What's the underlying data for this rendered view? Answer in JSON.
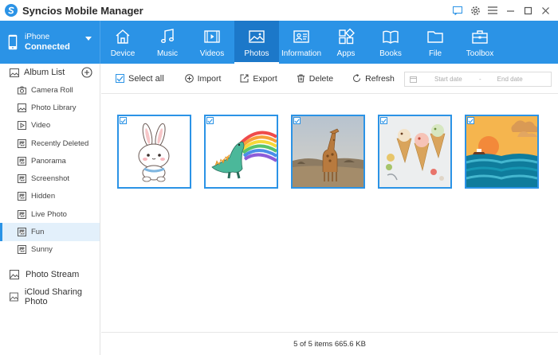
{
  "app": {
    "title": "Syncios Mobile Manager"
  },
  "device": {
    "name": "iPhone",
    "status": "Connected"
  },
  "nav": {
    "tabs": [
      {
        "label": "Device",
        "icon": "home-icon"
      },
      {
        "label": "Music",
        "icon": "music-icon"
      },
      {
        "label": "Videos",
        "icon": "film-icon"
      },
      {
        "label": "Photos",
        "icon": "image-icon",
        "active": true
      },
      {
        "label": "Information",
        "icon": "contact-card-icon"
      },
      {
        "label": "Apps",
        "icon": "apps-icon"
      },
      {
        "label": "Books",
        "icon": "book-icon"
      },
      {
        "label": "File",
        "icon": "folder-icon"
      },
      {
        "label": "Toolbox",
        "icon": "toolbox-icon"
      }
    ]
  },
  "sidebar": {
    "album_header": "Album List",
    "albums": [
      {
        "label": "Camera Roll",
        "icon": "camera-icon"
      },
      {
        "label": "Photo Library",
        "icon": "photo-icon"
      },
      {
        "label": "Video",
        "icon": "play-icon"
      },
      {
        "label": "Recently Deleted",
        "icon": "album-icon"
      },
      {
        "label": "Panorama",
        "icon": "album-icon"
      },
      {
        "label": "Screenshot",
        "icon": "album-icon"
      },
      {
        "label": "Hidden",
        "icon": "album-icon"
      },
      {
        "label": "Live Photo",
        "icon": "album-icon"
      },
      {
        "label": "Fun",
        "icon": "album-icon",
        "active": true
      },
      {
        "label": "Sunny",
        "icon": "album-icon"
      }
    ],
    "sections": [
      {
        "label": "Photo Stream",
        "icon": "photo-stream-icon"
      },
      {
        "label": "iCloud Sharing Photo",
        "icon": "icloud-share-icon"
      }
    ]
  },
  "toolbar": {
    "select_all": "Select all",
    "import": "Import",
    "export": "Export",
    "delete": "Delete",
    "refresh": "Refresh",
    "start_date_placeholder": "Start date",
    "date_separator": "-",
    "end_date_placeholder": "End date"
  },
  "photos": [
    {
      "name": "bunny-photo",
      "checked": true
    },
    {
      "name": "dinosaur-rainbow-photo",
      "checked": true
    },
    {
      "name": "giraffe-photo",
      "checked": true
    },
    {
      "name": "ice-cream-cones-photo",
      "checked": true
    },
    {
      "name": "paper-sea-sunset-photo",
      "checked": true
    }
  ],
  "status": {
    "summary": "5 of 5 items 665.6 KB"
  },
  "colors": {
    "accent": "#2b93e6",
    "accent_dark": "#1c78c9",
    "active_row": "#e3f0fb"
  }
}
